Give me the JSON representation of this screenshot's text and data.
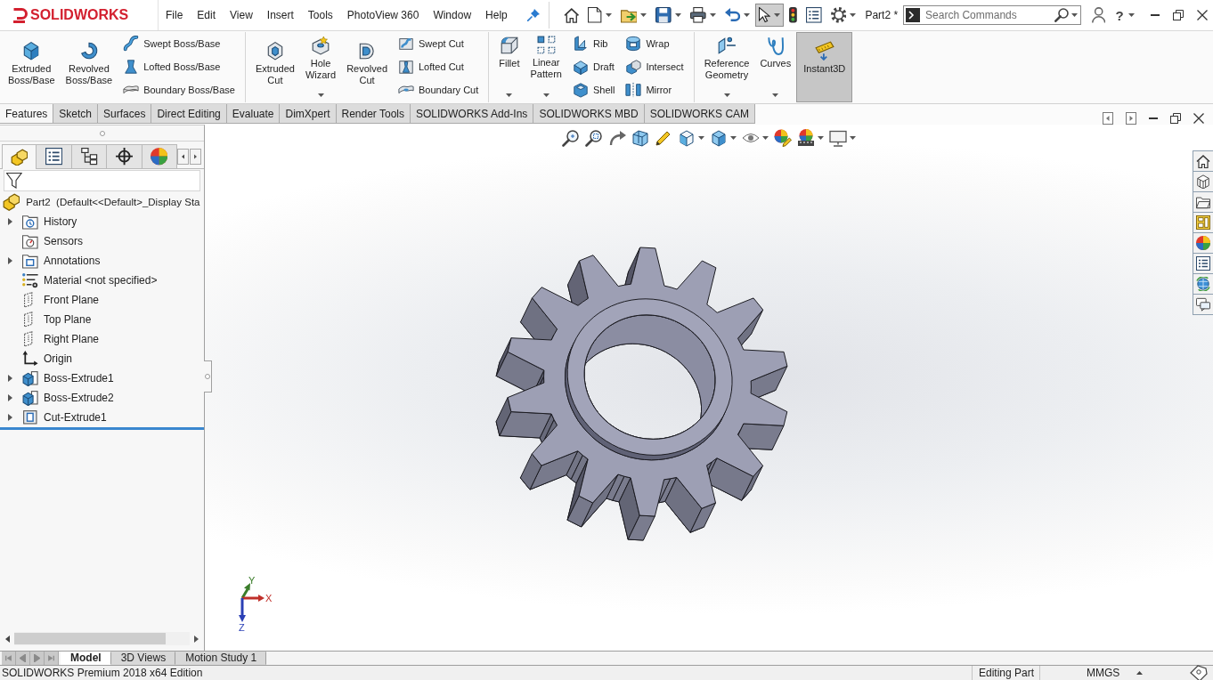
{
  "app": {
    "logo": "SOLIDWORKS"
  },
  "menu": [
    "File",
    "Edit",
    "View",
    "Insert",
    "Tools",
    "PhotoView 360",
    "Window",
    "Help"
  ],
  "quick_access": [
    {
      "menu": false,
      "selected": false
    },
    {
      "menu": true,
      "selected": false
    },
    {
      "menu": true,
      "selected": false
    },
    {
      "menu": true,
      "selected": false
    },
    {
      "menu": true,
      "selected": false
    },
    {
      "menu": true,
      "selected": false
    },
    {
      "menu": true,
      "selected": true
    },
    {
      "menu": false,
      "selected": false
    },
    {
      "menu": false,
      "selected": false
    },
    {
      "menu": true,
      "selected": false
    }
  ],
  "document_title": "Part2 *",
  "search": {
    "placeholder": "Search Commands"
  },
  "help": {
    "label": "?",
    "menu": true
  },
  "ribbon": {
    "groups": [
      {
        "columns": [
          {
            "kind": "large",
            "label": "Extruded Boss/Base",
            "menu": false,
            "on": false
          },
          {
            "kind": "large",
            "label": "Revolved Boss/Base",
            "menu": false,
            "on": false
          },
          {
            "kind": "stack",
            "items": [
              {
                "label": "Swept Boss/Base"
              },
              {
                "label": "Lofted Boss/Base"
              },
              {
                "label": "Boundary Boss/Base"
              }
            ]
          }
        ]
      },
      {
        "columns": [
          {
            "kind": "large",
            "label": "Extruded Cut",
            "menu": false,
            "on": false
          },
          {
            "kind": "large",
            "label": "Hole Wizard",
            "menu": true,
            "on": false
          },
          {
            "kind": "large",
            "label": "Revolved Cut",
            "menu": false,
            "on": false
          },
          {
            "kind": "stack",
            "items": [
              {
                "label": "Swept Cut"
              },
              {
                "label": "Lofted Cut"
              },
              {
                "label": "Boundary Cut"
              }
            ]
          }
        ]
      },
      {
        "columns": [
          {
            "kind": "large",
            "label": "Fillet",
            "menu": true,
            "on": false
          },
          {
            "kind": "large",
            "label": "Linear Pattern",
            "menu": true,
            "on": false
          },
          {
            "kind": "stack",
            "items": [
              {
                "label": "Rib"
              },
              {
                "label": "Draft"
              },
              {
                "label": "Shell"
              }
            ]
          },
          {
            "kind": "stack",
            "items": [
              {
                "label": "Wrap"
              },
              {
                "label": "Intersect"
              },
              {
                "label": "Mirror"
              }
            ]
          }
        ]
      },
      {
        "columns": [
          {
            "kind": "large",
            "label": "Reference Geometry",
            "menu": true,
            "on": false
          },
          {
            "kind": "large",
            "label": "Curves",
            "menu": true,
            "on": false
          },
          {
            "kind": "large",
            "label": "Instant3D",
            "menu": false,
            "on": true
          }
        ]
      }
    ]
  },
  "command_tabs": [
    {
      "label": "Features",
      "selected": true
    },
    {
      "label": "Sketch",
      "selected": false
    },
    {
      "label": "Surfaces",
      "selected": false
    },
    {
      "label": "Direct Editing",
      "selected": false
    },
    {
      "label": "Evaluate",
      "selected": false
    },
    {
      "label": "DimXpert",
      "selected": false
    },
    {
      "label": "Render Tools",
      "selected": false
    },
    {
      "label": "SOLIDWORKS Add-Ins",
      "selected": false
    },
    {
      "label": "SOLIDWORKS MBD",
      "selected": false
    },
    {
      "label": "SOLIDWORKS CAM",
      "selected": false
    }
  ],
  "feature_manager": {
    "tabs": [
      {
        "selected": true
      },
      {
        "selected": false
      },
      {
        "selected": false
      },
      {
        "selected": false
      },
      {
        "selected": false
      }
    ],
    "tree": {
      "label": "Part2  (Default<<Default>_Display Sta",
      "children": [
        {
          "label": "History",
          "expandable": true
        },
        {
          "label": "Sensors",
          "expandable": false
        },
        {
          "label": "Annotations",
          "expandable": true
        },
        {
          "label": "Material <not specified>",
          "expandable": false
        },
        {
          "label": "Front Plane",
          "expandable": false
        },
        {
          "label": "Top Plane",
          "expandable": false
        },
        {
          "label": "Right Plane",
          "expandable": false
        },
        {
          "label": "Origin",
          "expandable": false
        },
        {
          "label": "Boss-Extrude1",
          "expandable": true
        },
        {
          "label": "Boss-Extrude2",
          "expandable": true
        },
        {
          "label": "Cut-Extrude1",
          "expandable": true
        }
      ]
    }
  },
  "view_toolbar": [
    {
      "menu": false
    },
    {
      "menu": false
    },
    {
      "menu": false
    },
    {
      "menu": false
    },
    {
      "menu": false
    },
    {
      "menu": true
    },
    {
      "menu": true
    },
    {
      "menu": true
    },
    {
      "menu": false
    },
    {
      "menu": true
    },
    {
      "menu": true
    }
  ],
  "triad": {
    "x": "X",
    "y": "Y",
    "z": "Z"
  },
  "model_tabs": {
    "scroll_disabled": true,
    "tabs": [
      {
        "label": "Model",
        "selected": true
      },
      {
        "label": "3D Views",
        "selected": false
      },
      {
        "label": "Motion Study 1",
        "selected": false
      }
    ]
  },
  "status_bar": {
    "edition": "SOLIDWORKS Premium 2018 x64 Edition",
    "mode": "Editing Part",
    "units": "MMGS"
  }
}
